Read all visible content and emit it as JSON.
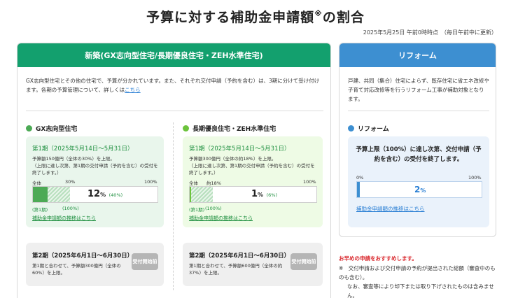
{
  "header": {
    "title": "予算に対する補助金申請額",
    "title_mark": "※",
    "title_suffix": "の割合",
    "timestamp": "2025年5月25日 午前0時時点　（毎日午前中に更新）"
  },
  "new_build": {
    "heading": "新築(GX志向型住宅/長期優良住宅・ZEH水準住宅)",
    "intro": "GX志向型住宅とその他の住宅で、予算が分かれています。また、それぞれ交付申請（予約を含む）は、3期に分けて受け付けます。各期の予算管理について、詳しくは",
    "intro_link": "こちら",
    "gx": {
      "title": "GX志向型住宅",
      "dot_color": "#4caa55",
      "period1": {
        "title": "第1期（2025年5月14日～5月31日）",
        "body1": "予算額150億円（全体の30%）を上限。",
        "body2": "（上限に達し次第、第1期の交付申請（予約を含む）の受付を終了します。）",
        "label_all": "全体",
        "label_mid": "30%",
        "label_end": "100%",
        "value": "12",
        "pct": "%",
        "sub": "(40%)",
        "progress": 0.12,
        "cap": 0.3,
        "foot1": "(第1期)",
        "foot2": "(100%)",
        "link": "補助金申請額の推移はこちら"
      },
      "period2": {
        "title": "第2期（2025年6月1日～6月30日）",
        "body": "第1期と合わせて、予算額300億円（全体の60%）を上限。",
        "badge": "受付開始前"
      }
    },
    "zeh": {
      "title": "長期優良住宅・ZEH水準住宅",
      "dot_color": "#6cc33c",
      "period1": {
        "title": "第1期（2025年5月14日～5月31日）",
        "body1": "予算額300億円（全体の約18%）を上限。",
        "body2": "（上限に達し次第、第1期の交付申請（予約を含む）の受付を終了します。）",
        "label_all": "全体",
        "label_mid": "約18%",
        "label_end": "100%",
        "value": "1",
        "pct": "%",
        "sub": "(6%)",
        "progress": 0.01,
        "cap": 0.18,
        "foot1": "(第1期)",
        "foot2": "(100%)",
        "link": "補助金申請額の推移はこちら"
      },
      "period2": {
        "title": "第2期（2025年6月1日～6月30日）",
        "body": "第1期と合わせて、予算額600億円（全体の約37%）を上限。",
        "badge": "受付開始前"
      }
    }
  },
  "reform": {
    "heading": "リフォーム",
    "intro": "戸建、共同（集合）住宅によらず、既存住宅に省エネ改修や子育て対応改修等を行うリフォーム工事が補助対象となります。",
    "section_title": "リフォーム",
    "dot_color": "#3d8fd1",
    "message": "予算上限（100%）に達し次第、交付申請（予約を含む）の受付を終了します。",
    "label_start": "0%",
    "label_end": "100%",
    "value": "2",
    "pct": "%",
    "progress": 0.02,
    "link": "補助金申請額の推移はこちら"
  },
  "notice": {
    "headline": "お早めの申請をおすすめします。",
    "note1": "※　交付申請および交付申請の予約が提出された総額（審査中のものも含む）。",
    "note2": "なお、審査等により却下または取り下げされたものは含みません。"
  }
}
